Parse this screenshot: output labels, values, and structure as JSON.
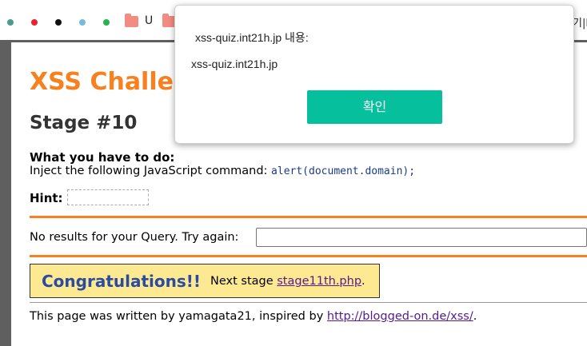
{
  "bookmarks": {
    "folder_label": "U",
    "right_text": "기|E"
  },
  "page": {
    "title": "XSS Challe",
    "stage": "Stage #10",
    "todo_heading": "What you have to do:",
    "todo_text": "Inject the following JavaScript command: ",
    "todo_code": "alert(document.domain);",
    "hint_label": "Hint:",
    "query_label": "No results for your Query. Try again:",
    "query_value": "",
    "congrats_title": "Congratulations!!",
    "next_stage_prefix": "Next stage ",
    "next_stage_link": "stage11th.php",
    "next_stage_suffix": ".",
    "footer_prefix": "This page was written by yamagata21, inspired by ",
    "footer_link": "http://blogged-on.de/xss/",
    "footer_suffix": "."
  },
  "dialog": {
    "title": "xss-quiz.int21h.jp 내용:",
    "message": "xss-quiz.int21h.jp",
    "ok_label": "확인"
  },
  "colors": {
    "title": "#f7811e",
    "congrats_bg": "#fde992",
    "congrats_text": "#2a4ba0",
    "dialog_button": "#05bf9d"
  }
}
